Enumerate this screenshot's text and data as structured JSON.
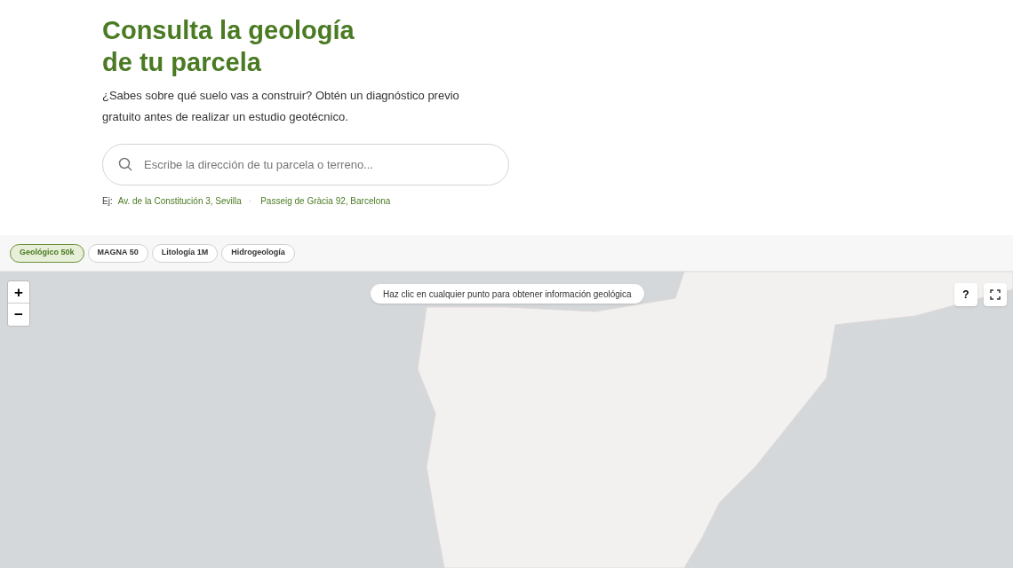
{
  "hero": {
    "title_lines": [
      "Consulta la geología",
      "de tu parcela"
    ],
    "subtitle": "¿Sabes sobre qué suelo vas a construir? Obtén un diagnóstico previo gratuito antes de realizar un estudio geotécnico.",
    "search": {
      "placeholder": "Escribe la dirección de tu parcela o terreno..."
    },
    "examples_label": "Ej:",
    "separator": "·",
    "examples": [
      "Av. de la Constitución 3, Sevilla",
      "Passeig de Gràcia 92, Barcelona"
    ]
  },
  "layers": [
    {
      "label": "Geológico 50k",
      "selected": true
    },
    {
      "label": "MAGNA 50",
      "selected": false
    },
    {
      "label": "Litología 1M",
      "selected": false
    },
    {
      "label": "Hidrogeología",
      "selected": false
    }
  ],
  "map": {
    "hint": "Haz clic en cualquier punto para obtener información geológica",
    "zoom_in": "+",
    "zoom_out": "−",
    "help": "?"
  }
}
